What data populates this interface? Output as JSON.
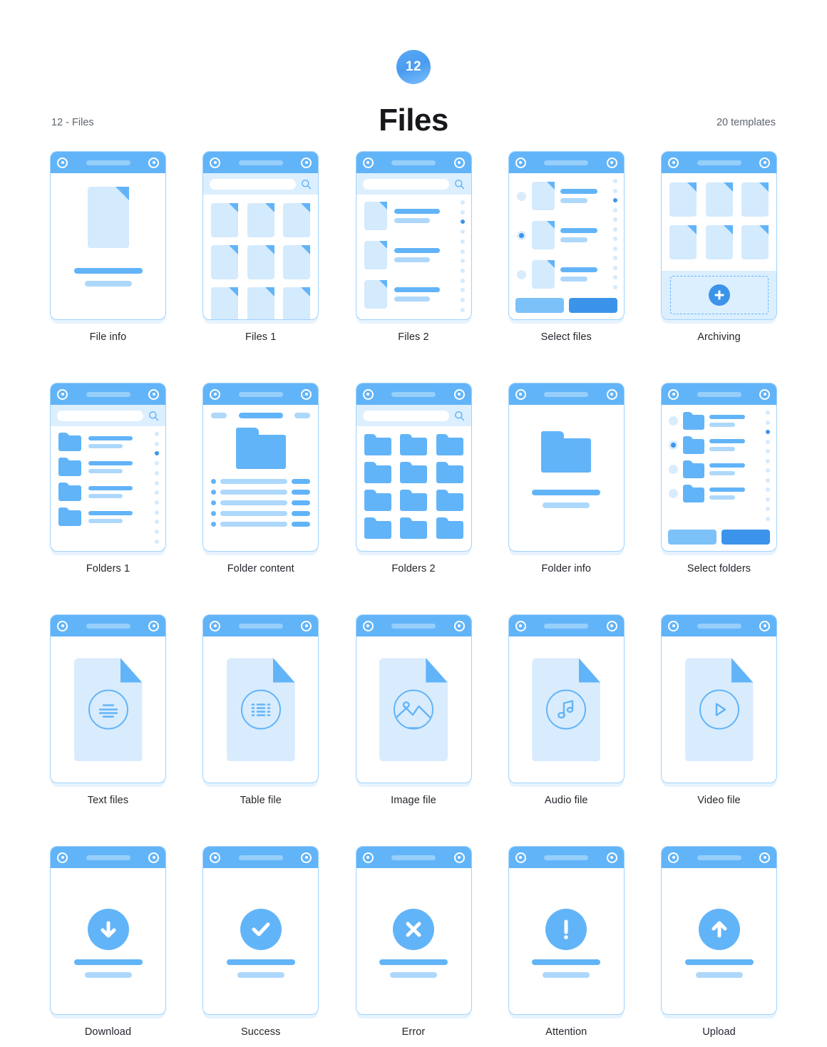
{
  "header": {
    "badge_number": "12",
    "title": "Files",
    "left_label": "12 - Files",
    "right_label": "20 templates"
  },
  "colors": {
    "primary_blue": "#62b4f8",
    "dark_blue": "#3c94ea",
    "light_blue": "#aed8fb",
    "pale_blue": "#d9ecfd",
    "strip_blue": "#dcefff",
    "card_border": "#9fd2fb",
    "white": "#ffffff",
    "label_text": "#22262c",
    "meta_text": "#5d6470"
  },
  "templates": [
    {
      "id": "file-info",
      "label": "File info",
      "kind": "info-file"
    },
    {
      "id": "files-1",
      "label": "Files 1",
      "kind": "file-grid-search"
    },
    {
      "id": "files-2",
      "label": "Files 2",
      "kind": "file-list-search"
    },
    {
      "id": "select-files",
      "label": "Select files",
      "kind": "file-select"
    },
    {
      "id": "archiving",
      "label": "Archiving",
      "kind": "archiving"
    },
    {
      "id": "folders-1",
      "label": "Folders 1",
      "kind": "folder-list-search"
    },
    {
      "id": "folder-content",
      "label": "Folder content",
      "kind": "folder-content"
    },
    {
      "id": "folders-2",
      "label": "Folders 2",
      "kind": "folder-grid-search"
    },
    {
      "id": "folder-info",
      "label": "Folder info",
      "kind": "info-folder"
    },
    {
      "id": "select-folders",
      "label": "Select folders",
      "kind": "folder-select"
    },
    {
      "id": "text-files",
      "label": "Text files",
      "kind": "filetype",
      "glyph": "text-lines-icon"
    },
    {
      "id": "table-file",
      "label": "Table file",
      "kind": "filetype",
      "glyph": "table-grid-icon"
    },
    {
      "id": "image-file",
      "label": "Image file",
      "kind": "filetype",
      "glyph": "image-mountain-icon"
    },
    {
      "id": "audio-file",
      "label": "Audio file",
      "kind": "filetype",
      "glyph": "music-note-icon"
    },
    {
      "id": "video-file",
      "label": "Video file",
      "kind": "filetype",
      "glyph": "play-triangle-icon"
    },
    {
      "id": "download",
      "label": "Download",
      "kind": "status",
      "glyph": "arrow-down-icon"
    },
    {
      "id": "success",
      "label": "Success",
      "kind": "status",
      "glyph": "check-icon"
    },
    {
      "id": "error",
      "label": "Error",
      "kind": "status",
      "glyph": "close-x-icon"
    },
    {
      "id": "attention",
      "label": "Attention",
      "kind": "status",
      "glyph": "exclamation-icon"
    },
    {
      "id": "upload",
      "label": "Upload",
      "kind": "status",
      "glyph": "arrow-up-icon"
    }
  ],
  "titlebar": {
    "left_icon": "circle-dot-icon",
    "right_icon": "circle-dot-icon",
    "center_element": "title-pill"
  },
  "search": {
    "icon": "search-icon",
    "value": "",
    "placeholder": ""
  },
  "counts": {
    "files_grid_rows": 3,
    "files_grid_cols": 3,
    "archiving_grid_rows": 2,
    "folders_grid_rows": 4,
    "list_items_files": 3,
    "list_items_folders": 4,
    "rail_dots": 12,
    "rail_active_index": 2,
    "folder_content_rows": 5
  },
  "actions": {
    "secondary_button": "",
    "primary_button": "",
    "add_button_icon": "plus-icon"
  }
}
